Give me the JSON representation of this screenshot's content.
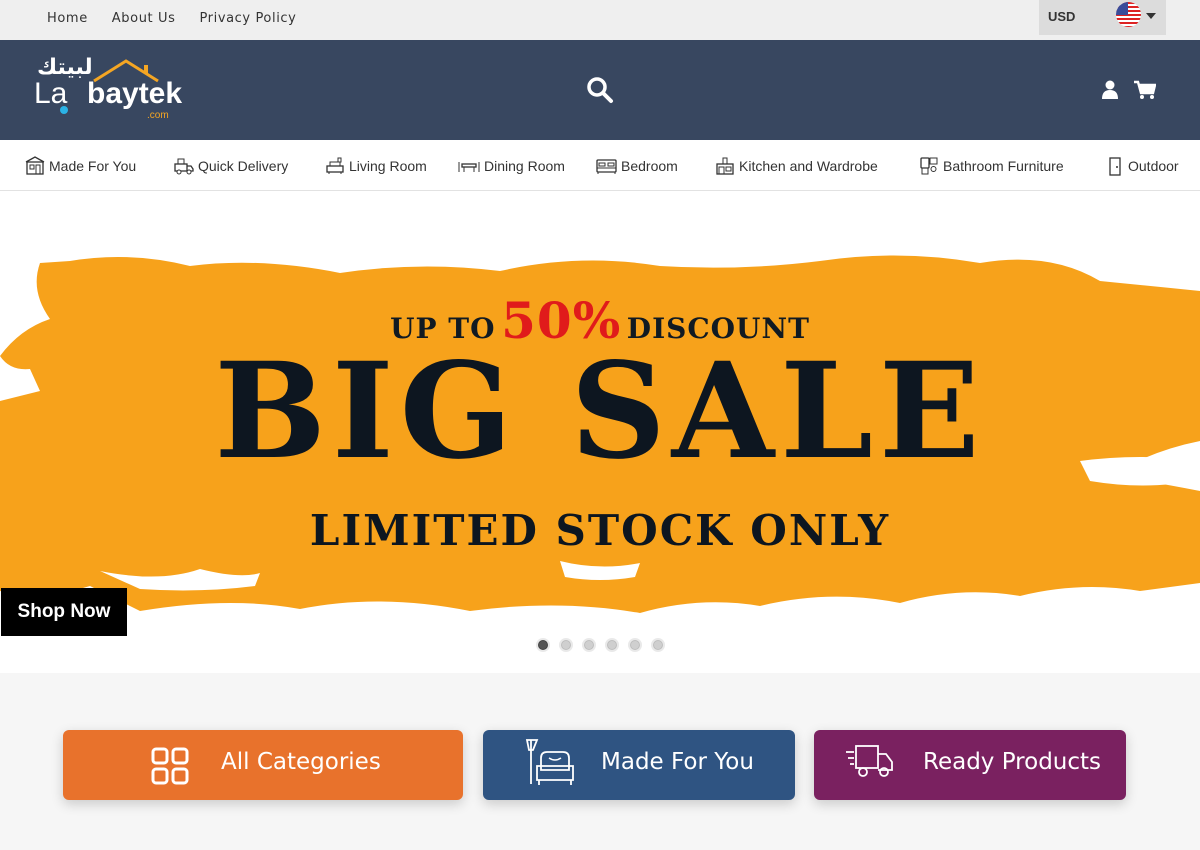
{
  "topbar": {
    "links": [
      "Home",
      "About Us",
      "Privacy Policy"
    ],
    "currency": "USD"
  },
  "header": {
    "logo": {
      "arabic": "لبيتك",
      "la": "La",
      "baytek": "baytek",
      "com": ".com"
    }
  },
  "categories": [
    {
      "label": "Made For You",
      "icon": "workshop-icon"
    },
    {
      "label": "Quick Delivery",
      "icon": "delivery-icon"
    },
    {
      "label": "Living Room",
      "icon": "living-room-icon"
    },
    {
      "label": "Dining Room",
      "icon": "dining-table-icon"
    },
    {
      "label": "Bedroom",
      "icon": "bed-icon"
    },
    {
      "label": "Kitchen and Wardrobe",
      "icon": "kitchen-icon"
    },
    {
      "label": "Bathroom Furniture",
      "icon": "bathroom-icon"
    },
    {
      "label": "Outdoor",
      "icon": "door-icon"
    }
  ],
  "banner": {
    "line1_prefix": "UP TO",
    "line1_percent": "50%",
    "line1_suffix": "DISCOUNT",
    "headline": "BIG SALE",
    "subline": "LIMITED STOCK ONLY",
    "shop_now": "Shop Now",
    "slides_total": 6,
    "active_slide": 1
  },
  "cards": [
    {
      "label": "All Categories",
      "icon": "grid-icon",
      "color": "#e8722c"
    },
    {
      "label": "Made For You",
      "icon": "armchair-lamp-icon",
      "color": "#2f5482"
    },
    {
      "label": "Ready Products",
      "icon": "fast-truck-icon",
      "color": "#7a2160"
    }
  ],
  "colors": {
    "header_bg": "#384760",
    "banner_accent": "#f7a21b",
    "percent_red": "#e01b1b"
  }
}
